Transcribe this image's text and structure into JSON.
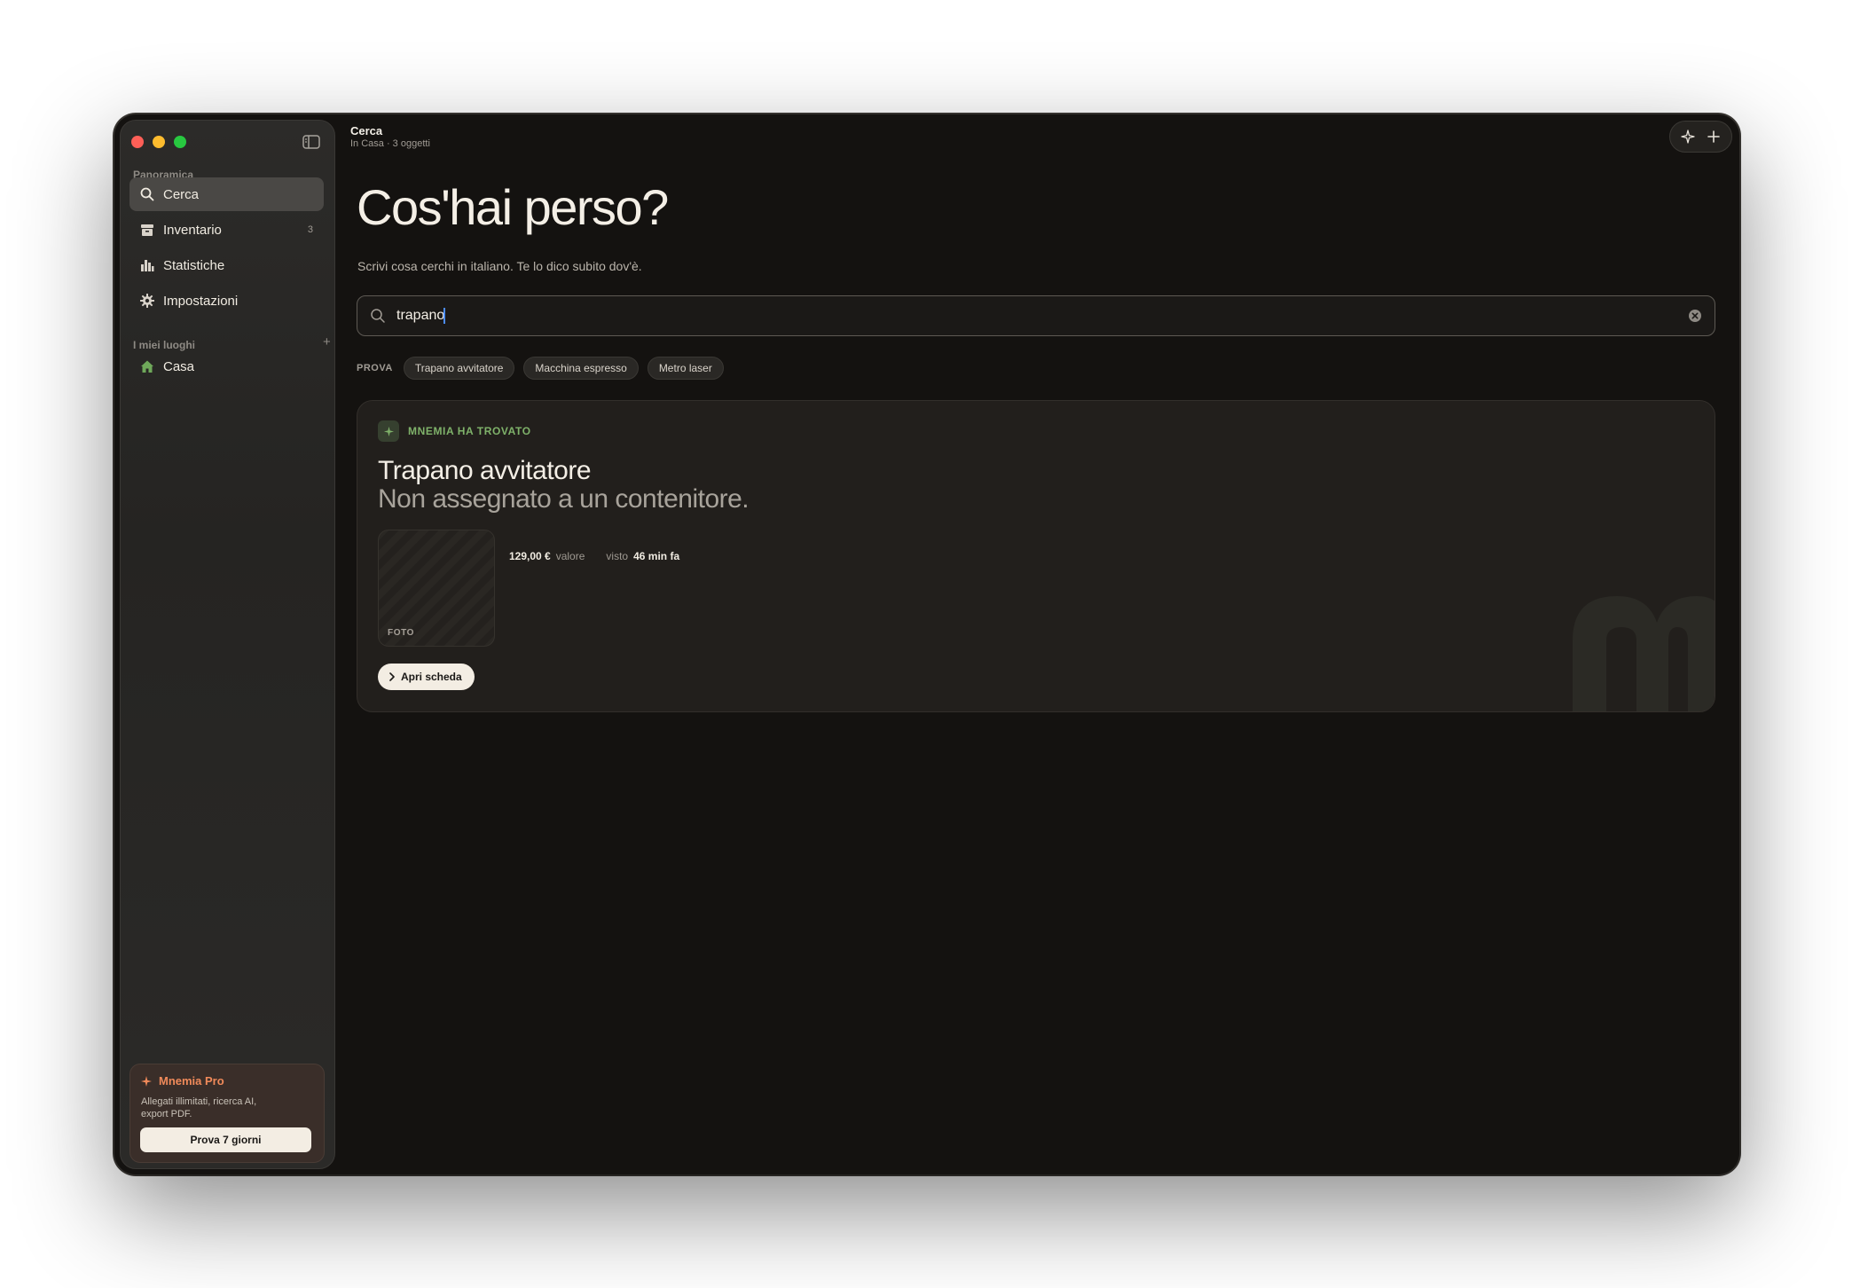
{
  "window": {
    "colors": {
      "background": "#141210",
      "accent_green": "#7fb26a",
      "accent_orange": "#f08a5a"
    }
  },
  "sidebar": {
    "section_overview": "Panoramica",
    "items": [
      {
        "label": "Cerca",
        "icon": "search-icon",
        "active": true
      },
      {
        "label": "Inventario",
        "icon": "archive-icon",
        "count": "3"
      },
      {
        "label": "Statistiche",
        "icon": "bar-chart-icon"
      },
      {
        "label": "Impostazioni",
        "icon": "gear-icon"
      }
    ],
    "section_places": "I miei luoghi",
    "add_place": "+",
    "places": [
      {
        "label": "Casa",
        "icon": "house-icon"
      }
    ],
    "pro": {
      "title": "Mnemia Pro",
      "description": "Allegati illimitati, ricerca AI, export PDF.",
      "button": "Prova 7 giorni"
    }
  },
  "header": {
    "title": "Cerca",
    "subtitle": "In Casa · 3 oggetti"
  },
  "main": {
    "hero_title": "Cos'hai perso?",
    "hero_subtitle": "Scrivi cosa cerchi in italiano. Te lo dico subito dov'è.",
    "search": {
      "value": "trapano"
    },
    "try_label": "PROVA",
    "suggestions": [
      "Trapano avvitatore",
      "Macchina espresso",
      "Metro laser"
    ],
    "result": {
      "badge": "MNEMIA HA TROVATO",
      "title": "Trapano avvitatore",
      "location": "Non assegnato a un contenitore.",
      "photo_label": "FOTO",
      "value": "129,00 €",
      "value_label": "valore",
      "seen_label": "visto",
      "seen_value": "46 min fa",
      "open_button": "Apri scheda"
    }
  }
}
